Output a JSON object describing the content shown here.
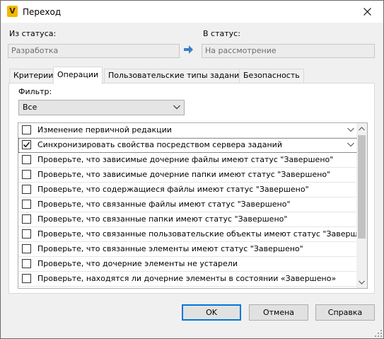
{
  "window": {
    "title": "Переход",
    "app_icon_letter": "V",
    "close_icon": "close-icon"
  },
  "from_status": {
    "label": "Из статуса:",
    "value": "Разработка"
  },
  "to_status": {
    "label": "В статус:",
    "value": "На рассмотрение"
  },
  "tabs": [
    {
      "label": "Критерии",
      "active": false
    },
    {
      "label": "Операции",
      "active": true
    },
    {
      "label": "Пользовательские типы заданий",
      "active": false
    },
    {
      "label": "Безопасность",
      "active": false
    }
  ],
  "filter": {
    "label": "Фильтр:",
    "value": "Все"
  },
  "operations": [
    {
      "label": "Изменение первичной редакции",
      "checked": false,
      "expandable": true
    },
    {
      "label": "Синхронизировать свойства посредством сервера заданий",
      "checked": true,
      "expandable": true
    },
    {
      "label": "Проверьте, что зависимые дочерние файлы имеют статус \"Завершено\"",
      "checked": false,
      "expandable": false
    },
    {
      "label": "Проверьте, что зависимые дочерние папки имеют статус \"Завершено\"",
      "checked": false,
      "expandable": false
    },
    {
      "label": "Проверьте, что содержащиеся файлы имеют статус \"Завершено\"",
      "checked": false,
      "expandable": false
    },
    {
      "label": "Проверьте, что связанные файлы имеют статус \"Завершено\"",
      "checked": false,
      "expandable": false
    },
    {
      "label": "Проверьте, что связанные папки имеют статус \"Завершено\"",
      "checked": false,
      "expandable": false
    },
    {
      "label": "Проверьте, что связанные пользовательские объекты имеют статус \"Завершено\"",
      "checked": false,
      "expandable": false
    },
    {
      "label": "Проверьте, что связанные элементы имеют статус \"Завершено\"",
      "checked": false,
      "expandable": false
    },
    {
      "label": "Проверьте, что дочерние элементы не устарели",
      "checked": false,
      "expandable": false
    },
    {
      "label": "Проверьте, находятся ли дочерние элементы в состоянии «Завершено»",
      "checked": false,
      "expandable": false
    },
    {
      "label": "",
      "checked": false,
      "expandable": false
    }
  ],
  "buttons": {
    "ok": "OK",
    "cancel": "Отмена",
    "help": "Справка"
  },
  "colors": {
    "accent": "#0078d7",
    "app_icon": "#f2b800",
    "arrow": "#3b7fc4"
  }
}
